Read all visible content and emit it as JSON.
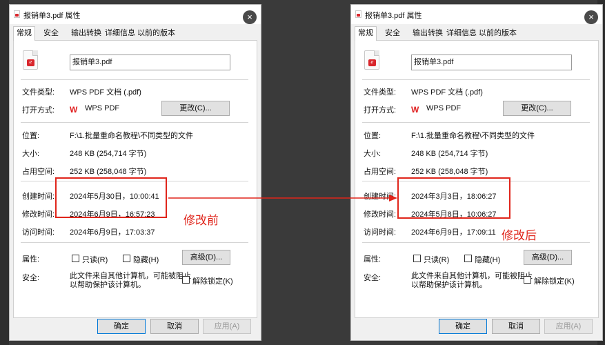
{
  "dialogs": [
    {
      "title": "报销单3.pdf 属性",
      "tabs": [
        "常规",
        "安全",
        "输出转换",
        "详细信息",
        "以前的版本"
      ],
      "filename": "报销单3.pdf",
      "file_type_label": "文件类型:",
      "file_type": "WPS PDF 文档 (.pdf)",
      "open_with_label": "打开方式:",
      "open_with": "WPS PDF",
      "change_button": "更改(C)...",
      "location_label": "位置:",
      "location": "F:\\1.批量重命名教程\\不同类型的文件",
      "size_label": "大小:",
      "size": "248 KB (254,714 字节)",
      "disk_size_label": "占用空间:",
      "disk_size": "252 KB (258,048 字节)",
      "created_label": "创建时间:",
      "created": "2024年5月30日，10:00:41",
      "modified_label": "修改时间:",
      "modified": "2024年6月9日，16:57:23",
      "accessed_label": "访问时间:",
      "accessed": "2024年6月9日，17:03:37",
      "attributes_label": "属性:",
      "readonly_label": "只读(R)",
      "hidden_label": "隐藏(H)",
      "advanced_button": "高级(D)...",
      "security_label": "安全:",
      "security_line1": "此文件来自其他计算机，可能被阻止",
      "security_line2": "以帮助保护该计算机。",
      "unblock_label": "解除锁定(K)",
      "ok_button": "确定",
      "cancel_button": "取消",
      "apply_button": "应用(A)",
      "annotation": "修改前"
    },
    {
      "title": "报销单3.pdf 属性",
      "tabs": [
        "常规",
        "安全",
        "输出转换",
        "详细信息",
        "以前的版本"
      ],
      "filename": "报销单3.pdf",
      "file_type_label": "文件类型:",
      "file_type": "WPS PDF 文档 (.pdf)",
      "open_with_label": "打开方式:",
      "open_with": "WPS PDF",
      "change_button": "更改(C)...",
      "location_label": "位置:",
      "location": "F:\\1.批量重命名教程\\不同类型的文件",
      "size_label": "大小:",
      "size": "248 KB (254,714 字节)",
      "disk_size_label": "占用空间:",
      "disk_size": "252 KB (258,048 字节)",
      "created_label": "创建时间:",
      "created": "2024年3月3日，18:06:27",
      "modified_label": "修改时间:",
      "modified": "2024年5月8日，10:06:27",
      "accessed_label": "访问时间:",
      "accessed": "2024年6月9日，17:09:11",
      "attributes_label": "属性:",
      "readonly_label": "只读(R)",
      "hidden_label": "隐藏(H)",
      "advanced_button": "高级(D)...",
      "security_label": "安全:",
      "security_line1": "此文件来自其他计算机，可能被阻止",
      "security_line2": "以帮助保护该计算机。",
      "unblock_label": "解除锁定(K)",
      "ok_button": "确定",
      "cancel_button": "取消",
      "apply_button": "应用(A)",
      "annotation": "修改后"
    }
  ],
  "colors": {
    "highlight_red": "#e0251b",
    "dialog_bg": "#f0f0f0",
    "panel_bg": "#ffffff",
    "backdrop": "#3a3a3a"
  }
}
